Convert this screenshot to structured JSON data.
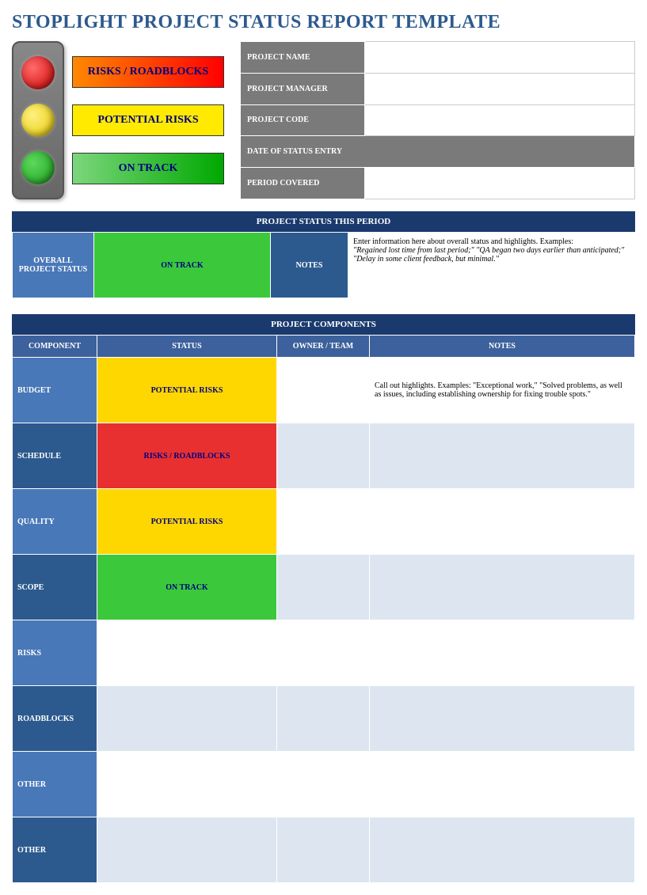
{
  "title": "STOPLIGHT PROJECT STATUS REPORT TEMPLATE",
  "legend": {
    "red": "RISKS / ROADBLOCKS",
    "yellow": "POTENTIAL RISKS",
    "green": "ON TRACK"
  },
  "meta": {
    "project_name_label": "PROJECT NAME",
    "project_name_value": "",
    "project_manager_label": "PROJECT MANAGER",
    "project_manager_value": "",
    "project_code_label": "PROJECT CODE",
    "project_code_value": "",
    "date_entry_label": "DATE OF STATUS ENTRY",
    "period_covered_label": "PERIOD COVERED",
    "period_covered_value": ""
  },
  "status_section": {
    "header": "PROJECT STATUS THIS PERIOD",
    "overall_label": "OVERALL PROJECT STATUS",
    "overall_value": "ON TRACK",
    "notes_label": "NOTES",
    "notes_intro": "Enter information here about overall status and highlights. Examples:",
    "notes_example": "\"Regained lost time from last period;\" \"QA began two days earlier than anticipated;\" \"Delay in some client feedback, but minimal.\""
  },
  "components_section": {
    "header": "PROJECT COMPONENTS",
    "columns": {
      "component": "COMPONENT",
      "status": "STATUS",
      "owner": "OWNER / TEAM",
      "notes": "NOTES"
    },
    "rows": [
      {
        "label": "BUDGET",
        "status": "POTENTIAL RISKS",
        "status_type": "potential",
        "owner": "",
        "notes": "Call out highlights. Examples: \"Exceptional work,\" \"Solved problems, as well as issues, including establishing ownership for fixing trouble spots.\""
      },
      {
        "label": "SCHEDULE",
        "status": "RISKS / ROADBLOCKS",
        "status_type": "risks",
        "owner": "",
        "notes": ""
      },
      {
        "label": "QUALITY",
        "status": "POTENTIAL RISKS",
        "status_type": "potential",
        "owner": "",
        "notes": ""
      },
      {
        "label": "SCOPE",
        "status": "ON TRACK",
        "status_type": "ontrack",
        "owner": "",
        "notes": ""
      },
      {
        "label": "RISKS",
        "status": "",
        "status_type": "",
        "owner": "",
        "notes": ""
      },
      {
        "label": "ROADBLOCKS",
        "status": "",
        "status_type": "",
        "owner": "",
        "notes": ""
      },
      {
        "label": "OTHER",
        "status": "",
        "status_type": "",
        "owner": "",
        "notes": ""
      },
      {
        "label": "OTHER",
        "status": "",
        "status_type": "",
        "owner": "",
        "notes": ""
      }
    ]
  }
}
